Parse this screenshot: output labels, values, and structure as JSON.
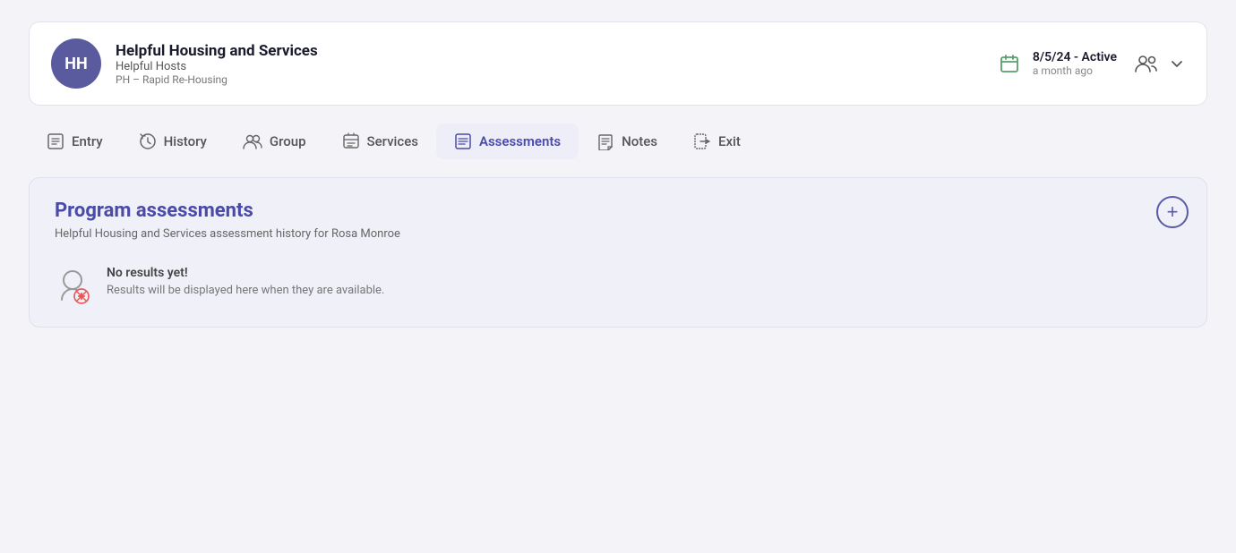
{
  "header": {
    "avatar_initials": "HH",
    "org_name": "Helpful Housing and Services",
    "org_sub": "Helpful Hosts",
    "org_type": "PH – Rapid Re-Housing",
    "status_date": "8/5/24 - Active",
    "status_ago": "a month ago"
  },
  "nav": {
    "tabs": [
      {
        "id": "entry",
        "label": "Entry",
        "active": false
      },
      {
        "id": "history",
        "label": "History",
        "active": false
      },
      {
        "id": "group",
        "label": "Group",
        "active": false
      },
      {
        "id": "services",
        "label": "Services",
        "active": false
      },
      {
        "id": "assessments",
        "label": "Assessments",
        "active": true
      },
      {
        "id": "notes",
        "label": "Notes",
        "active": false
      },
      {
        "id": "exit",
        "label": "Exit",
        "active": false
      }
    ]
  },
  "content": {
    "section_title": "Program assessments",
    "section_subtitle": "Helpful Housing and Services assessment history for Rosa Monroe",
    "no_results_title": "No results yet!",
    "no_results_subtitle": "Results will be displayed here when they are available.",
    "add_button_label": "+"
  }
}
